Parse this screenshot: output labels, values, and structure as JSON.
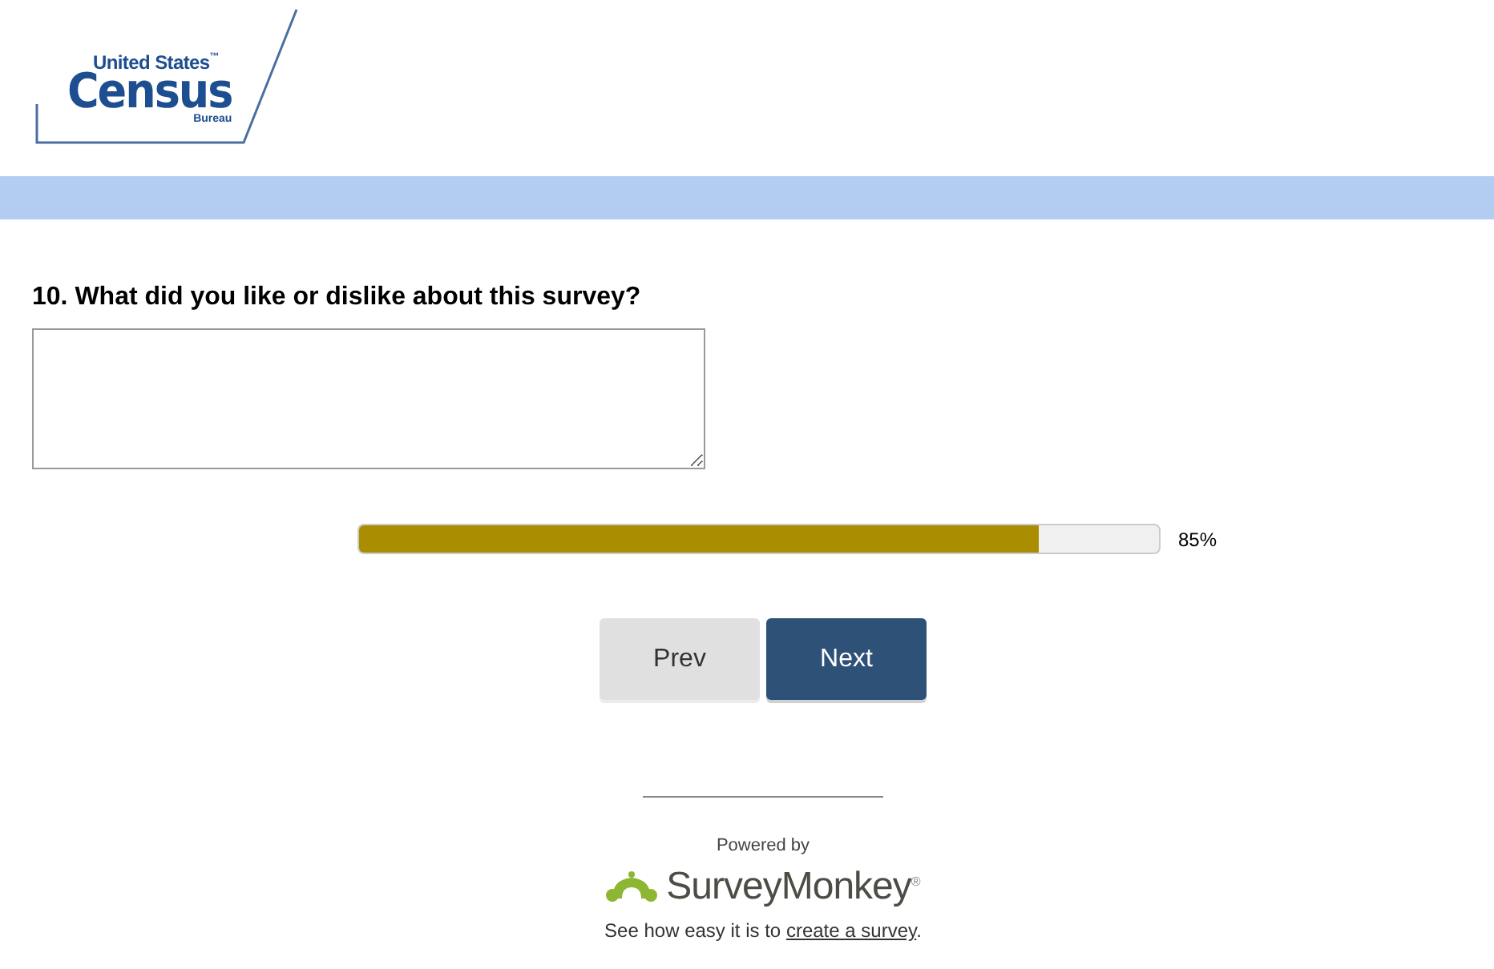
{
  "logo": {
    "top_line": "United States",
    "trademark": "™",
    "main_word": "Census",
    "bottom_line": "Bureau"
  },
  "question": {
    "number": "10.",
    "text": "What did you like or dislike about this survey?"
  },
  "progress": {
    "level": 0.85,
    "reading": "85%"
  },
  "buttons": [
    {
      "label": "Prev",
      "kind": "secondary"
    },
    {
      "label": "Next",
      "kind": "primary"
    }
  ],
  "footer": {
    "powered_by": "Powered by",
    "brand": "SurveyMonkey",
    "registered": "®",
    "tagline": "See how easy it is to",
    "link": "create a survey",
    "end": "."
  }
}
